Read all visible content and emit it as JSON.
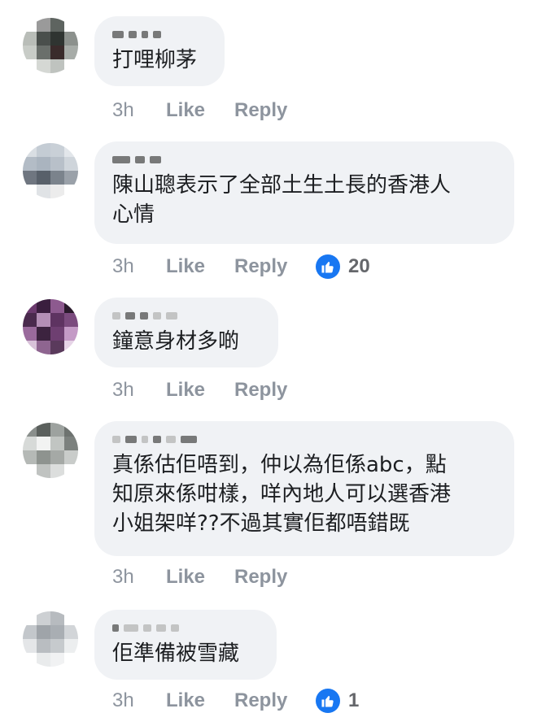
{
  "comments": [
    {
      "text": "打哩柳茅",
      "time": "3h",
      "like": "Like",
      "reply": "Reply",
      "reactions": ""
    },
    {
      "text": "陳山聰表示了全部土生土長的香港人\n心情",
      "time": "3h",
      "like": "Like",
      "reply": "Reply",
      "reactions": "20"
    },
    {
      "text": "鐘意身材多啲",
      "time": "3h",
      "like": "Like",
      "reply": "Reply",
      "reactions": ""
    },
    {
      "text": "真係估佢唔到，仲以為佢係abc，點\n知原來係咁樣，咩內地人可以選香港\n小姐架咩??不過其實佢都唔錯既",
      "time": "3h",
      "like": "Like",
      "reply": "Reply",
      "reactions": ""
    },
    {
      "text": "佢準備被雪藏",
      "time": "3h",
      "like": "Like",
      "reply": "Reply",
      "reactions": "1"
    }
  ],
  "colors": {
    "bubble": "#f0f2f5",
    "action": "#8d949e",
    "reaction_blue": "#1877f2"
  },
  "icons": {
    "reaction": "thumbs-up-icon",
    "avatar": "pixelated-avatar"
  }
}
